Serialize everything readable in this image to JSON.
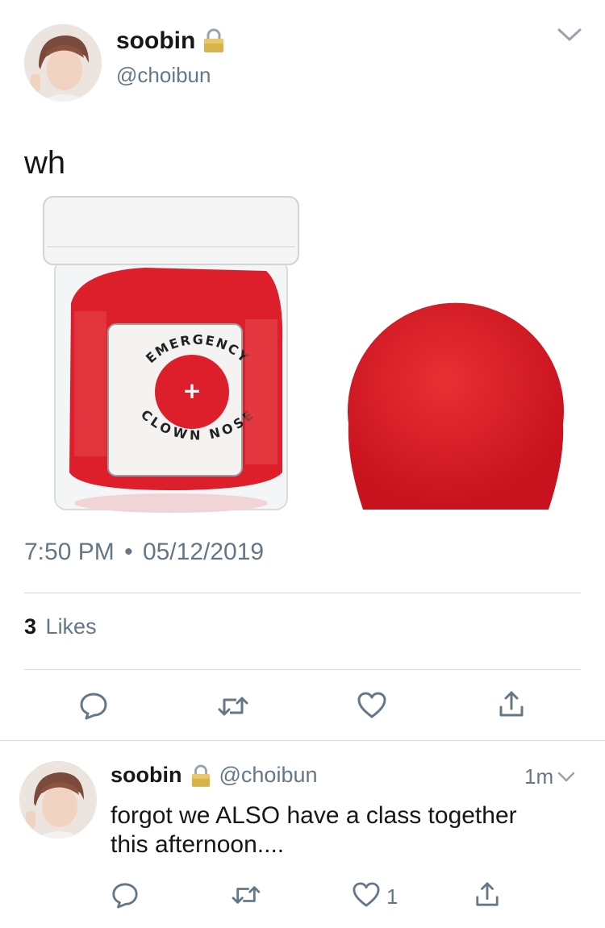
{
  "main_tweet": {
    "display_name": "soobin",
    "handle": "@choibun",
    "text": "wh",
    "time": "7:50 PM",
    "separator": "•",
    "date": "05/12/2019",
    "likes_count": "3",
    "likes_label": "Likes",
    "icons": [
      "reply-icon",
      "retweet-icon",
      "like-icon",
      "share-icon"
    ],
    "image": {
      "jar_label_top": "EMERGENCY",
      "jar_label_bottom": "CLOWN NOSE",
      "jar_registered": "®"
    }
  },
  "reply_tweet": {
    "display_name": "soobin",
    "handle": "@choibun",
    "time_ago": "1m",
    "text_line1": "forgot we ALSO have a class together",
    "text_line2": "this afternoon....",
    "like_count": "1"
  },
  "colors": {
    "text": "#14171a",
    "muted": "#657786",
    "icon": "#657786",
    "divider": "#d3d6da",
    "clown_red": "#dc1f2a"
  }
}
